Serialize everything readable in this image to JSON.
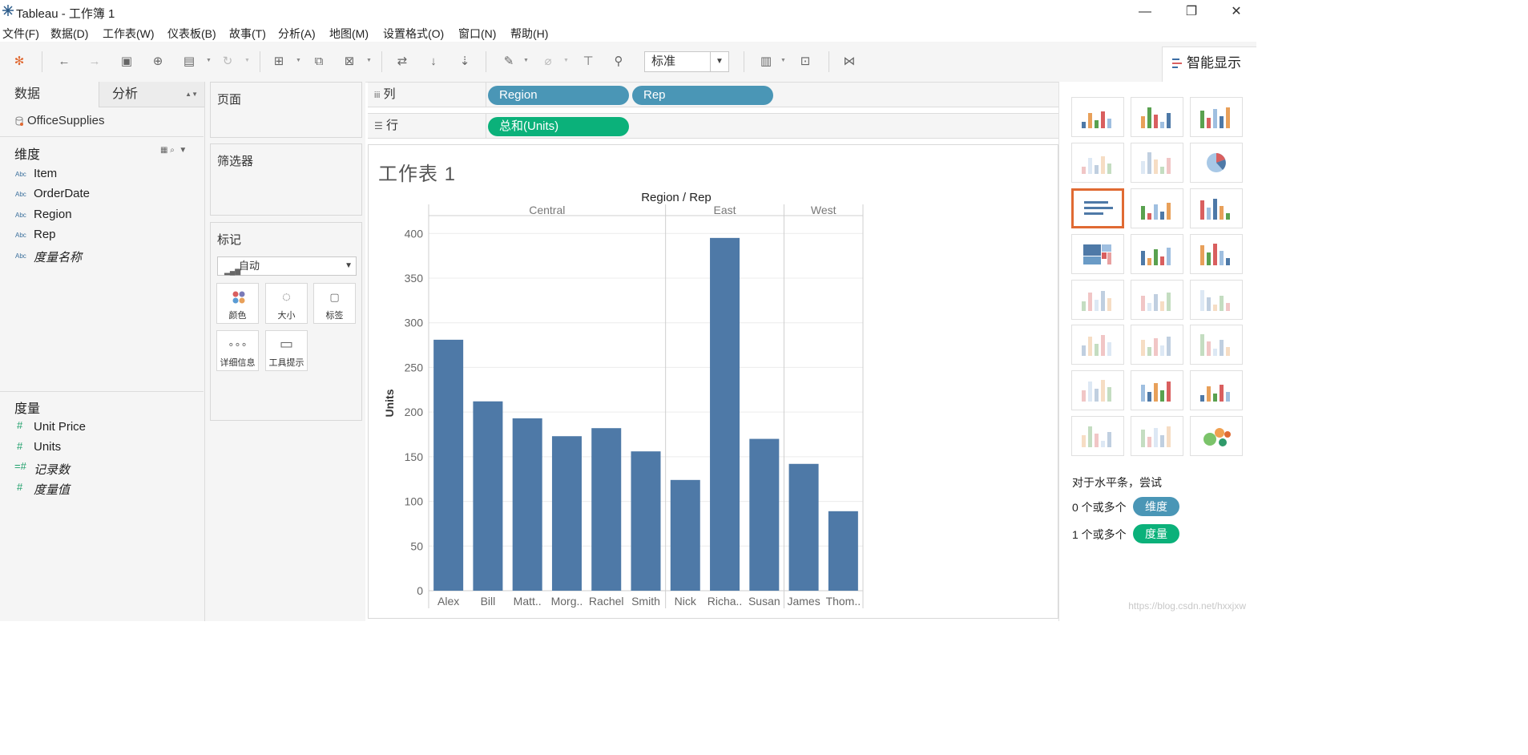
{
  "window": {
    "title": "Tableau - 工作簿 1",
    "minimize": "—",
    "maximize": "❐",
    "close": "✕"
  },
  "menu": [
    "文件(F)",
    "数据(D)",
    "工作表(W)",
    "仪表板(B)",
    "故事(T)",
    "分析(A)",
    "地图(M)",
    "设置格式(O)",
    "窗口(N)",
    "帮助(H)"
  ],
  "toolbar": {
    "fit_value": "标准",
    "show_me_label": "智能显示"
  },
  "data_pane": {
    "tab_data": "数据",
    "tab_analysis": "分析",
    "datasource": "OfficeSupplies",
    "dimensions_header": "维度",
    "dimensions": [
      {
        "type": "Abc",
        "name": "Item"
      },
      {
        "type": "Abc",
        "name": "OrderDate"
      },
      {
        "type": "Abc",
        "name": "Region"
      },
      {
        "type": "Abc",
        "name": "Rep"
      },
      {
        "type": "Abc",
        "name": "度量名称"
      }
    ],
    "measures_header": "度量",
    "measures": [
      {
        "type": "#",
        "name": "Unit Price"
      },
      {
        "type": "#",
        "name": "Units"
      },
      {
        "type": "=#",
        "name": "记录数"
      },
      {
        "type": "#",
        "name": "度量值"
      }
    ]
  },
  "cards": {
    "pages": "页面",
    "filters": "筛选器",
    "marks": "标记",
    "marks_type": "自动",
    "mark_buttons": [
      "颜色",
      "大小",
      "标签",
      "详细信息",
      "工具提示"
    ]
  },
  "shelves": {
    "columns_label": "列",
    "rows_label": "行",
    "columns_pills": [
      "Region",
      "Rep"
    ],
    "rows_pills": [
      "总和(Units)"
    ]
  },
  "sheet_title": "工作表 1",
  "chart_data": {
    "type": "bar",
    "header": "Region / Rep",
    "ylabel": "Units",
    "ylim": [
      0,
      420
    ],
    "yticks": [
      0,
      50,
      100,
      150,
      200,
      250,
      300,
      350,
      400
    ],
    "grid": true,
    "regions": [
      {
        "name": "Central",
        "reps": [
          "Alex",
          "Bill",
          "Matt..",
          "Morg..",
          "Rachel",
          "Smith"
        ],
        "values": [
          281,
          212,
          193,
          173,
          182,
          156
        ]
      },
      {
        "name": "East",
        "reps": [
          "Nick",
          "Richa..",
          "Susan"
        ],
        "values": [
          124,
          395,
          170
        ]
      },
      {
        "name": "West",
        "reps": [
          "James",
          "Thom.."
        ],
        "values": [
          142,
          89
        ]
      }
    ],
    "bar_color": "#4e79a7"
  },
  "show_me": {
    "hint_title": "对于水平条，尝试",
    "hint_dim_prefix": "0 个或多个",
    "hint_dim_pill": "维度",
    "hint_mea_prefix": "1 个或多个",
    "hint_mea_pill": "度量",
    "selected_index": 6
  },
  "watermark": "https://blog.csdn.net/hxxjxw"
}
